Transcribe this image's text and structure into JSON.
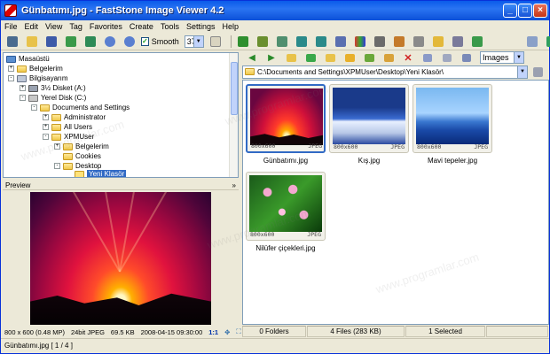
{
  "window": {
    "title": "Günbatımı.jpg  -  FastStone Image Viewer 4.2",
    "minimize_glyph": "_",
    "maximize_glyph": "□",
    "close_glyph": "×"
  },
  "menu": [
    "File",
    "Edit",
    "View",
    "Tag",
    "Favorites",
    "Create",
    "Tools",
    "Settings",
    "Help"
  ],
  "toolbar": {
    "smooth_label": "Smooth",
    "smooth_checked": true,
    "zoom_value": "37%"
  },
  "tree": {
    "items": [
      {
        "label": "Masaüstü",
        "level": 0,
        "expander": "",
        "icon": "desktop-icon"
      },
      {
        "label": "Belgelerim",
        "level": 1,
        "expander": "+",
        "icon": "folder-icon"
      },
      {
        "label": "Bilgisayarım",
        "level": 1,
        "expander": "-",
        "icon": "computer-icon"
      },
      {
        "label": "3½ Disket (A:)",
        "level": 2,
        "expander": "+",
        "icon": "floppy-icon"
      },
      {
        "label": "Yerel Disk (C:)",
        "level": 2,
        "expander": "-",
        "icon": "drive-icon"
      },
      {
        "label": "Documents and Settings",
        "level": 3,
        "expander": "-",
        "icon": "folder-icon"
      },
      {
        "label": "Administrator",
        "level": 4,
        "expander": "+",
        "icon": "folder-icon"
      },
      {
        "label": "All Users",
        "level": 4,
        "expander": "+",
        "icon": "folder-icon"
      },
      {
        "label": "XPMUser",
        "level": 4,
        "expander": "-",
        "icon": "folder-icon"
      },
      {
        "label": "Belgelerim",
        "level": 5,
        "expander": "+",
        "icon": "folder-icon"
      },
      {
        "label": "Cookies",
        "level": 5,
        "expander": "",
        "icon": "folder-icon"
      },
      {
        "label": "Desktop",
        "level": 5,
        "expander": "-",
        "icon": "folder-icon"
      },
      {
        "label": "Yeni Klasör",
        "level": 6,
        "expander": "",
        "icon": "folder-open-icon",
        "selected": true
      }
    ]
  },
  "preview": {
    "header": "Preview",
    "info": [
      "800 x 600 (0.48 MP)",
      "24bit JPEG",
      "69.5 KB",
      "2008-04-15 09:30:00",
      "1:1"
    ]
  },
  "path": {
    "value": "C:\\Documents and Settings\\XPMUser\\Desktop\\Yeni Klasör\\",
    "filter_value": "Images"
  },
  "thumbnails": [
    {
      "caption": "Günbatımı.jpg",
      "size": "800x600",
      "format": "JPEG",
      "selected": true
    },
    {
      "caption": "Kış.jpg",
      "size": "800x600",
      "format": "JPEG"
    },
    {
      "caption": "Mavi tepeler.jpg",
      "size": "800x600",
      "format": "JPEG"
    },
    {
      "caption": "Nilüfer çiçekleri.jpg",
      "size": "800x600",
      "format": "JPEG"
    }
  ],
  "status": {
    "folders": "0 Folders",
    "files": "4 Files (283 KB)",
    "selected": "1 Selected"
  },
  "bottom": {
    "text": "Günbatımı.jpg [ 1 / 4 ]"
  },
  "watermark": "www.programlar.com"
}
